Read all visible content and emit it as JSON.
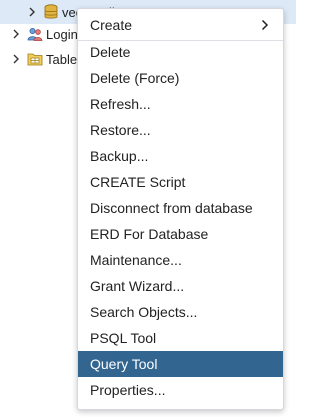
{
  "colors": {
    "active_item_bg": "#326690",
    "active_item_text": "#ffffff",
    "tree_selected_bg": "#dde9f7"
  },
  "tree": {
    "items": [
      {
        "label": "vector_db",
        "icon": "database-icon",
        "selected": true
      },
      {
        "label": "Login/Group Roles",
        "icon": "roles-icon",
        "selected": false
      },
      {
        "label": "Tablespaces",
        "icon": "tablespaces-icon",
        "selected": false
      }
    ]
  },
  "context_menu": {
    "create_label": "Create",
    "items": [
      "Delete",
      "Delete (Force)",
      "Refresh...",
      "Restore...",
      "Backup...",
      "CREATE Script",
      "Disconnect from database",
      "ERD For Database",
      "Maintenance...",
      "Grant Wizard...",
      "Search Objects...",
      "PSQL Tool",
      "Query Tool",
      "Properties..."
    ],
    "active_item": "Query Tool"
  }
}
